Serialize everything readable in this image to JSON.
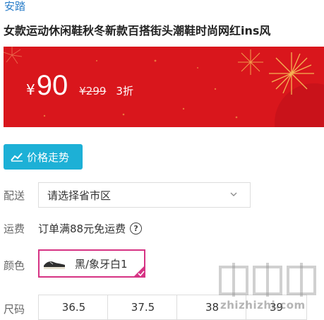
{
  "product": {
    "brand": "安踏",
    "title": "女款运动休闲鞋秋冬新款百搭街头潮鞋时尚网红ins风"
  },
  "price": {
    "currency": "¥",
    "current": "90",
    "original": "¥299",
    "discount": "3折"
  },
  "trend_button": {
    "label": "价格走势",
    "icon": "trend-chart-icon"
  },
  "delivery": {
    "label": "配送",
    "region_placeholder": "请选择省市区"
  },
  "shipping": {
    "label": "运费",
    "text": "订单满88元免运费",
    "help_icon": "question-circle-icon"
  },
  "color": {
    "label": "颜色",
    "selected": "黑/象牙白1"
  },
  "size": {
    "label": "尺码",
    "options": [
      "36.5",
      "37.5",
      "38",
      "39"
    ]
  },
  "watermark": {
    "text": "zhizhizhi.com",
    "logo": "值值值"
  },
  "colors": {
    "brand_link": "#2a7ec9",
    "banner_red": "#d9161c",
    "trend_button": "#1db0d6",
    "selected_border": "#d63384"
  }
}
